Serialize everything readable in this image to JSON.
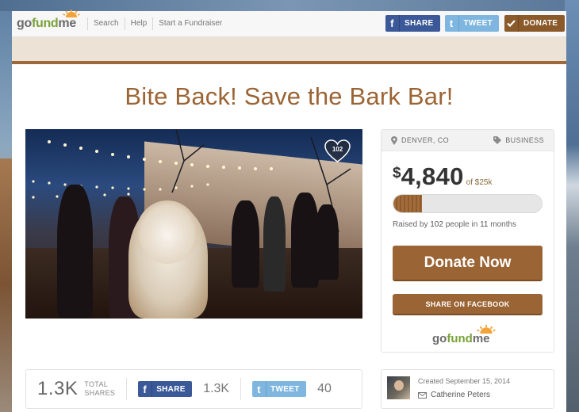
{
  "header": {
    "logo": {
      "go": "go",
      "fund": "fund",
      "me": "me"
    },
    "nav": [
      "Search",
      "Help",
      "Start a Fundraiser"
    ],
    "share_label": "SHARE",
    "tweet_label": "TWEET",
    "donate_label": "DONATE"
  },
  "campaign": {
    "title": "Bite Back! Save the Bark Bar!",
    "likes": "102",
    "location": "DENVER, CO",
    "category": "BUSINESS",
    "currency": "$",
    "raised": "4,840",
    "goal": "of $25k",
    "progress_fraction": 0.1936,
    "raised_by_prefix": "Raised by ",
    "raised_by_count": "102",
    "raised_by_mid": " people in ",
    "raised_by_months": "11",
    "raised_by_suffix": " months",
    "donate_now": "Donate Now",
    "share_facebook": "SHARE ON FACEBOOK",
    "side_logo": {
      "go": "go",
      "fund": "fund",
      "me": "me"
    }
  },
  "sharebar": {
    "total_count": "1.3K",
    "total_label_1": "TOTAL",
    "total_label_2": "SHARES",
    "share_label": "SHARE",
    "share_count": "1.3K",
    "tweet_label": "TWEET",
    "tweet_count": "40"
  },
  "creator": {
    "created": "Created September 15, 2014",
    "name": "Catherine Peters"
  },
  "colors": {
    "brand_brown": "#9b6434",
    "facebook": "#3b5998",
    "twitter": "#7fb6e0",
    "logo_green": "#7aa23a"
  }
}
